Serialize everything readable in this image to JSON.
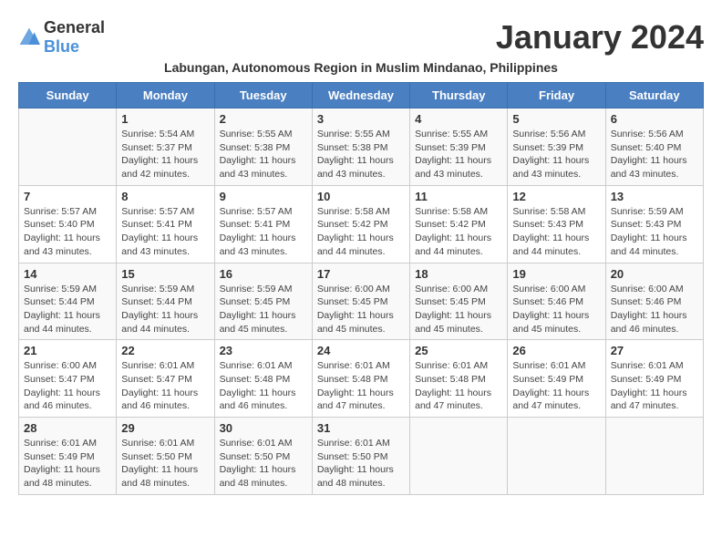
{
  "logo": {
    "general": "General",
    "blue": "Blue"
  },
  "title": "January 2024",
  "subtitle": "Labungan, Autonomous Region in Muslim Mindanao, Philippines",
  "days_of_week": [
    "Sunday",
    "Monday",
    "Tuesday",
    "Wednesday",
    "Thursday",
    "Friday",
    "Saturday"
  ],
  "weeks": [
    [
      {
        "day": "",
        "info": ""
      },
      {
        "day": "1",
        "info": "Sunrise: 5:54 AM\nSunset: 5:37 PM\nDaylight: 11 hours\nand 42 minutes."
      },
      {
        "day": "2",
        "info": "Sunrise: 5:55 AM\nSunset: 5:38 PM\nDaylight: 11 hours\nand 43 minutes."
      },
      {
        "day": "3",
        "info": "Sunrise: 5:55 AM\nSunset: 5:38 PM\nDaylight: 11 hours\nand 43 minutes."
      },
      {
        "day": "4",
        "info": "Sunrise: 5:55 AM\nSunset: 5:39 PM\nDaylight: 11 hours\nand 43 minutes."
      },
      {
        "day": "5",
        "info": "Sunrise: 5:56 AM\nSunset: 5:39 PM\nDaylight: 11 hours\nand 43 minutes."
      },
      {
        "day": "6",
        "info": "Sunrise: 5:56 AM\nSunset: 5:40 PM\nDaylight: 11 hours\nand 43 minutes."
      }
    ],
    [
      {
        "day": "7",
        "info": "Sunrise: 5:57 AM\nSunset: 5:40 PM\nDaylight: 11 hours\nand 43 minutes."
      },
      {
        "day": "8",
        "info": "Sunrise: 5:57 AM\nSunset: 5:41 PM\nDaylight: 11 hours\nand 43 minutes."
      },
      {
        "day": "9",
        "info": "Sunrise: 5:57 AM\nSunset: 5:41 PM\nDaylight: 11 hours\nand 43 minutes."
      },
      {
        "day": "10",
        "info": "Sunrise: 5:58 AM\nSunset: 5:42 PM\nDaylight: 11 hours\nand 44 minutes."
      },
      {
        "day": "11",
        "info": "Sunrise: 5:58 AM\nSunset: 5:42 PM\nDaylight: 11 hours\nand 44 minutes."
      },
      {
        "day": "12",
        "info": "Sunrise: 5:58 AM\nSunset: 5:43 PM\nDaylight: 11 hours\nand 44 minutes."
      },
      {
        "day": "13",
        "info": "Sunrise: 5:59 AM\nSunset: 5:43 PM\nDaylight: 11 hours\nand 44 minutes."
      }
    ],
    [
      {
        "day": "14",
        "info": "Sunrise: 5:59 AM\nSunset: 5:44 PM\nDaylight: 11 hours\nand 44 minutes."
      },
      {
        "day": "15",
        "info": "Sunrise: 5:59 AM\nSunset: 5:44 PM\nDaylight: 11 hours\nand 44 minutes."
      },
      {
        "day": "16",
        "info": "Sunrise: 5:59 AM\nSunset: 5:45 PM\nDaylight: 11 hours\nand 45 minutes."
      },
      {
        "day": "17",
        "info": "Sunrise: 6:00 AM\nSunset: 5:45 PM\nDaylight: 11 hours\nand 45 minutes."
      },
      {
        "day": "18",
        "info": "Sunrise: 6:00 AM\nSunset: 5:45 PM\nDaylight: 11 hours\nand 45 minutes."
      },
      {
        "day": "19",
        "info": "Sunrise: 6:00 AM\nSunset: 5:46 PM\nDaylight: 11 hours\nand 45 minutes."
      },
      {
        "day": "20",
        "info": "Sunrise: 6:00 AM\nSunset: 5:46 PM\nDaylight: 11 hours\nand 46 minutes."
      }
    ],
    [
      {
        "day": "21",
        "info": "Sunrise: 6:00 AM\nSunset: 5:47 PM\nDaylight: 11 hours\nand 46 minutes."
      },
      {
        "day": "22",
        "info": "Sunrise: 6:01 AM\nSunset: 5:47 PM\nDaylight: 11 hours\nand 46 minutes."
      },
      {
        "day": "23",
        "info": "Sunrise: 6:01 AM\nSunset: 5:48 PM\nDaylight: 11 hours\nand 46 minutes."
      },
      {
        "day": "24",
        "info": "Sunrise: 6:01 AM\nSunset: 5:48 PM\nDaylight: 11 hours\nand 47 minutes."
      },
      {
        "day": "25",
        "info": "Sunrise: 6:01 AM\nSunset: 5:48 PM\nDaylight: 11 hours\nand 47 minutes."
      },
      {
        "day": "26",
        "info": "Sunrise: 6:01 AM\nSunset: 5:49 PM\nDaylight: 11 hours\nand 47 minutes."
      },
      {
        "day": "27",
        "info": "Sunrise: 6:01 AM\nSunset: 5:49 PM\nDaylight: 11 hours\nand 47 minutes."
      }
    ],
    [
      {
        "day": "28",
        "info": "Sunrise: 6:01 AM\nSunset: 5:49 PM\nDaylight: 11 hours\nand 48 minutes."
      },
      {
        "day": "29",
        "info": "Sunrise: 6:01 AM\nSunset: 5:50 PM\nDaylight: 11 hours\nand 48 minutes."
      },
      {
        "day": "30",
        "info": "Sunrise: 6:01 AM\nSunset: 5:50 PM\nDaylight: 11 hours\nand 48 minutes."
      },
      {
        "day": "31",
        "info": "Sunrise: 6:01 AM\nSunset: 5:50 PM\nDaylight: 11 hours\nand 48 minutes."
      },
      {
        "day": "",
        "info": ""
      },
      {
        "day": "",
        "info": ""
      },
      {
        "day": "",
        "info": ""
      }
    ]
  ]
}
